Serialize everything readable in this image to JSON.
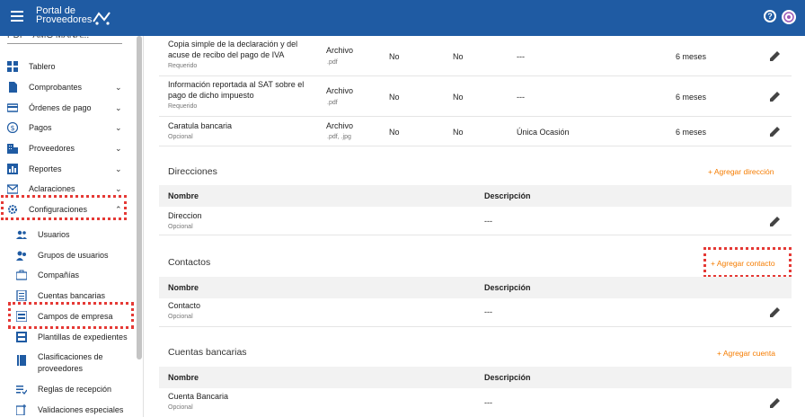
{
  "header": {
    "logo_line1": "Portal de",
    "logo_line2": "Proveedores",
    "help_icon": "help-icon",
    "avatar_icon": "avatar-icon"
  },
  "sidebar": {
    "company": "PDF - AMG MANA...",
    "items": [
      {
        "label": "Tablero",
        "icon": "dashboard-icon"
      },
      {
        "label": "Comprobantes",
        "icon": "document-icon"
      },
      {
        "label": "Órdenes de pago",
        "icon": "card-icon"
      },
      {
        "label": "Pagos",
        "icon": "dollar-icon"
      },
      {
        "label": "Proveedores",
        "icon": "building-icon"
      },
      {
        "label": "Reportes",
        "icon": "chart-icon"
      },
      {
        "label": "Aclaraciones",
        "icon": "mail-icon"
      },
      {
        "label": "Configuraciones",
        "icon": "gear-icon"
      }
    ],
    "sub_items": [
      {
        "label": "Usuarios",
        "icon": "users-icon"
      },
      {
        "label": "Grupos de usuarios",
        "icon": "group-icon"
      },
      {
        "label": "Compañías",
        "icon": "briefcase-icon"
      },
      {
        "label": "Cuentas bancarias",
        "icon": "list-icon"
      },
      {
        "label": "Campos de empresa",
        "icon": "fields-icon"
      },
      {
        "label": "Plantillas de expedientes",
        "icon": "template-icon"
      },
      {
        "label": "Clasificaciones de proveedores",
        "icon": "book-icon"
      },
      {
        "label": "Reglas de recepción",
        "icon": "rules-icon"
      },
      {
        "label": "Validaciones especiales",
        "icon": "add-doc-icon"
      }
    ]
  },
  "documents": [
    {
      "name": "Copia simple de la declaración y del acuse de recibo del pago de IVA",
      "req": "Requerido",
      "type": "Archivo",
      "ext": ".pdf",
      "c1": "No",
      "c2": "No",
      "freq": "---",
      "period": "6 meses"
    },
    {
      "name": "Información reportada al SAT sobre el pago de dicho impuesto",
      "req": "Requerido",
      "type": "Archivo",
      "ext": ".pdf",
      "c1": "No",
      "c2": "No",
      "freq": "---",
      "period": "6 meses"
    },
    {
      "name": "Caratula bancaria",
      "req": "Opcional",
      "type": "Archivo",
      "ext": ".pdf, .jpg",
      "c1": "No",
      "c2": "No",
      "freq": "Única Ocasión",
      "period": "6 meses"
    }
  ],
  "direcciones": {
    "title": "Direcciones",
    "add": "Agregar dirección",
    "col_name": "Nombre",
    "col_desc": "Descripción",
    "row": {
      "name": "Direccion",
      "req": "Opcional",
      "desc": "---"
    }
  },
  "contactos": {
    "title": "Contactos",
    "add": "Agregar contacto",
    "col_name": "Nombre",
    "col_desc": "Descripción",
    "row": {
      "name": "Contacto",
      "req": "Opcional",
      "desc": "---"
    }
  },
  "cuentas": {
    "title": "Cuentas bancarias",
    "add": "Agregar cuenta",
    "col_name": "Nombre",
    "col_desc": "Descripción",
    "row": {
      "name": "Cuenta Bancaria",
      "req": "Opcional",
      "desc": "---"
    }
  },
  "colors": {
    "header": "#1f5ba3",
    "accent": "#f57c00",
    "highlight": "#e53935"
  }
}
